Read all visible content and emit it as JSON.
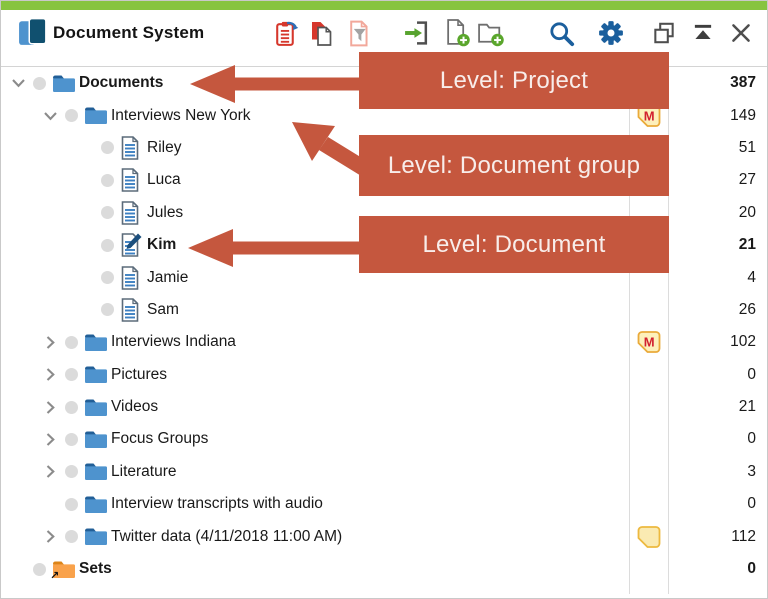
{
  "header": {
    "title": "Document System",
    "toolbar_icons": [
      "paste-clipboard-icon",
      "copy-documents-icon",
      "filter-documents-icon",
      "import-documents-icon",
      "new-document-icon",
      "new-document-group-icon",
      "search-icon",
      "settings-gear-icon",
      "undock-icon",
      "collapse-icon",
      "close-icon"
    ]
  },
  "tree": {
    "rows": [
      {
        "label": "Documents",
        "level": 0,
        "chevron": "down",
        "icon": "folder",
        "bold": true,
        "count": "387",
        "count_bold": true,
        "badge": null
      },
      {
        "label": "Interviews New York",
        "level": 1,
        "chevron": "down",
        "icon": "folder",
        "bold": false,
        "count": "149",
        "count_bold": false,
        "badge": "memo-m"
      },
      {
        "label": "Riley",
        "level": 2,
        "chevron": null,
        "icon": "doc",
        "bold": false,
        "count": "51",
        "count_bold": false,
        "badge": null
      },
      {
        "label": "Luca",
        "level": 2,
        "chevron": null,
        "icon": "doc",
        "bold": false,
        "count": "27",
        "count_bold": false,
        "badge": null
      },
      {
        "label": "Jules",
        "level": 2,
        "chevron": null,
        "icon": "doc",
        "bold": false,
        "count": "20",
        "count_bold": false,
        "badge": null
      },
      {
        "label": "Kim",
        "level": 2,
        "chevron": null,
        "icon": "doc-edit",
        "bold": true,
        "count": "21",
        "count_bold": true,
        "badge": null
      },
      {
        "label": "Jamie",
        "level": 2,
        "chevron": null,
        "icon": "doc",
        "bold": false,
        "count": "4",
        "count_bold": false,
        "badge": null
      },
      {
        "label": "Sam",
        "level": 2,
        "chevron": null,
        "icon": "doc",
        "bold": false,
        "count": "26",
        "count_bold": false,
        "badge": null
      },
      {
        "label": "Interviews Indiana",
        "level": 1,
        "chevron": "right",
        "icon": "folder",
        "bold": false,
        "count": "102",
        "count_bold": false,
        "badge": "memo-m"
      },
      {
        "label": "Pictures",
        "level": 1,
        "chevron": "right",
        "icon": "folder",
        "bold": false,
        "count": "0",
        "count_bold": false,
        "badge": null
      },
      {
        "label": "Videos",
        "level": 1,
        "chevron": "right",
        "icon": "folder",
        "bold": false,
        "count": "21",
        "count_bold": false,
        "badge": null
      },
      {
        "label": "Focus Groups",
        "level": 1,
        "chevron": "right",
        "icon": "folder",
        "bold": false,
        "count": "0",
        "count_bold": false,
        "badge": null
      },
      {
        "label": "Literature",
        "level": 1,
        "chevron": "right",
        "icon": "folder",
        "bold": false,
        "count": "3",
        "count_bold": false,
        "badge": null
      },
      {
        "label": "Interview transcripts with audio",
        "level": 1,
        "chevron": null,
        "icon": "folder",
        "bold": false,
        "count": "0",
        "count_bold": false,
        "badge": null
      },
      {
        "label": "Twitter data (4/11/2018 11:00 AM)",
        "level": 1,
        "chevron": "right",
        "icon": "folder",
        "bold": false,
        "count": "112",
        "count_bold": false,
        "badge": "memo"
      },
      {
        "label": "Sets",
        "level": 0,
        "chevron": null,
        "icon": "folder-sets",
        "bold": true,
        "count": "0",
        "count_bold": true,
        "badge": null
      }
    ]
  },
  "annotations": {
    "boxes": [
      {
        "label": "Level: Project"
      },
      {
        "label": "Level: Document group"
      },
      {
        "label": "Level: Document"
      }
    ]
  },
  "colors": {
    "annotation_red": "#c5573e",
    "header_green": "#87c440",
    "icon_red": "#d6372c",
    "icon_blue": "#1b5f9d",
    "folder_blue_body": "#4e93ce",
    "folder_blue_tab": "#225f97",
    "sets_orange_body": "#f9a24b",
    "sets_orange_tab": "#dd8519",
    "badge_fill": "#fdf0bb",
    "badge_border": "#eaaa3a",
    "memo_letter_red": "#d2202f",
    "dot_gray": "#dbdbdb"
  }
}
